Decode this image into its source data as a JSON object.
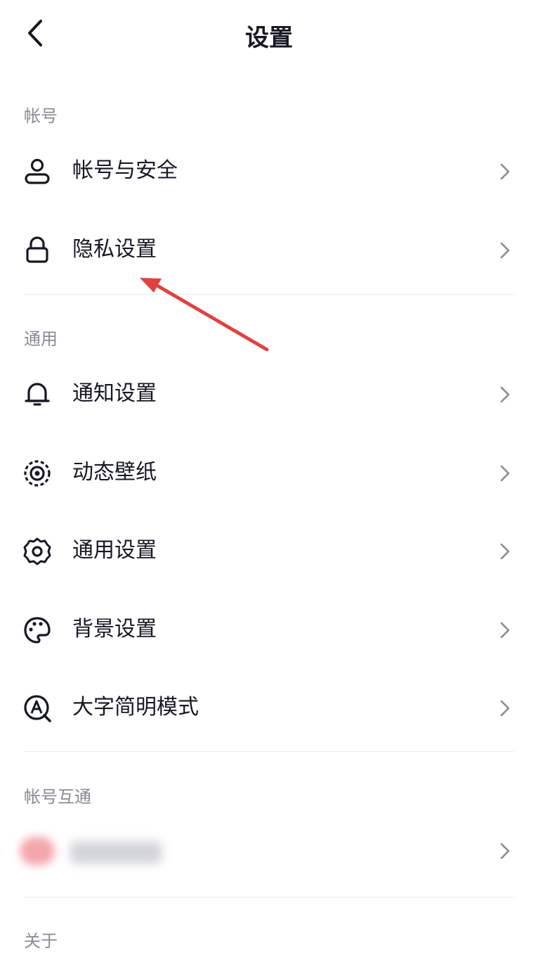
{
  "header": {
    "title": "设置",
    "back_icon": "chevron-left-icon"
  },
  "sections": [
    {
      "title": "帐号",
      "items": [
        {
          "label": "帐号与安全",
          "icon": "user-icon"
        },
        {
          "label": "隐私设置",
          "icon": "lock-icon"
        }
      ]
    },
    {
      "title": "通用",
      "items": [
        {
          "label": "通知设置",
          "icon": "bell-icon"
        },
        {
          "label": "动态壁纸",
          "icon": "live-wallpaper-icon"
        },
        {
          "label": "通用设置",
          "icon": "gear-icon"
        },
        {
          "label": "背景设置",
          "icon": "palette-icon"
        },
        {
          "label": "大字简明模式",
          "icon": "large-font-icon"
        }
      ]
    },
    {
      "title": "帐号互通",
      "items": [
        {
          "label": "",
          "icon": "blurred-app-icon",
          "blurred": true
        }
      ]
    },
    {
      "title": "关于",
      "items": []
    }
  ],
  "colors": {
    "text_primary": "#161823",
    "text_secondary": "#8a8b91",
    "divider": "#ececec",
    "annotation_arrow": "#e0423f"
  }
}
